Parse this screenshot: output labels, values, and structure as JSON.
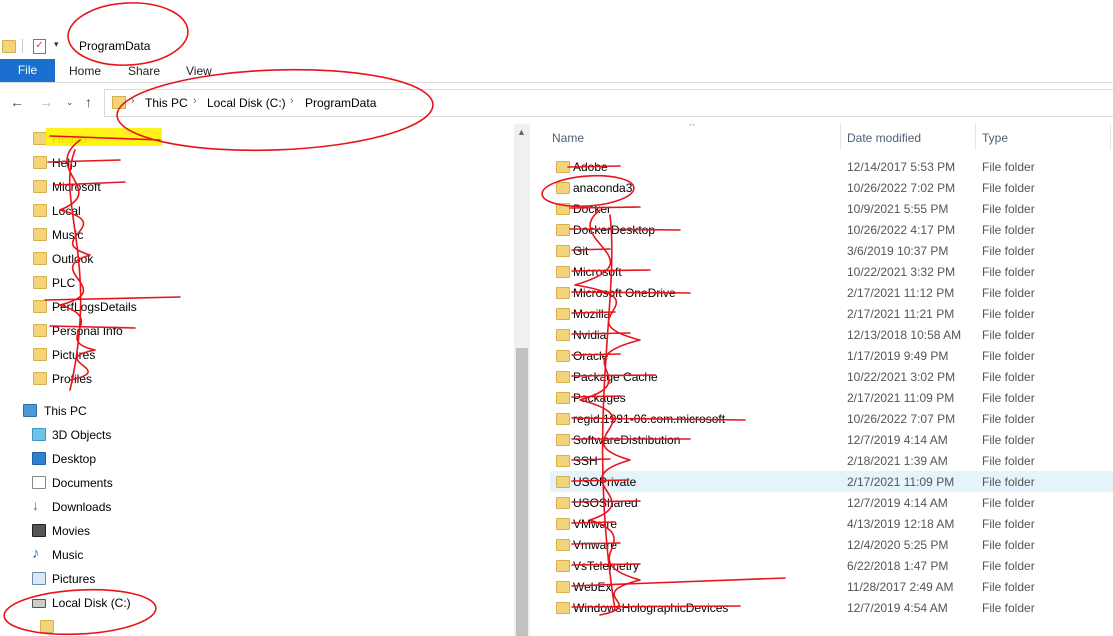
{
  "window": {
    "title": "ProgramData"
  },
  "ribbon": {
    "tabs": [
      "File",
      "Home",
      "Share",
      "View"
    ]
  },
  "address": {
    "crumbs": [
      "This PC",
      "Local Disk (C:)",
      "ProgramData"
    ],
    "separator": "›"
  },
  "nav_pane": {
    "folders": [
      "Health",
      "Help",
      "Microsoft",
      "Local",
      "Music",
      "Outlook",
      "PLC",
      "PerfLogsDetails",
      "Personal Info",
      "Pictures",
      "Profiles"
    ],
    "this_pc": "This PC",
    "pc_items": [
      {
        "label": "3D Objects",
        "icon": "3d-objects-icon"
      },
      {
        "label": "Desktop",
        "icon": "desktop-icon"
      },
      {
        "label": "Documents",
        "icon": "documents-icon"
      },
      {
        "label": "Downloads",
        "icon": "downloads-icon"
      },
      {
        "label": "Movies",
        "icon": "movies-icon"
      },
      {
        "label": "Music",
        "icon": "music-icon"
      },
      {
        "label": "Pictures",
        "icon": "pictures-icon"
      }
    ],
    "drive": "Local Disk (C:)"
  },
  "list": {
    "columns": {
      "name": "Name",
      "date": "Date modified",
      "type": "Type"
    },
    "rows": [
      {
        "name": "Adobe",
        "date": "12/14/2017 5:53 PM",
        "type": "File folder"
      },
      {
        "name": "anaconda3",
        "date": "10/26/2022 7:02 PM",
        "type": "File folder"
      },
      {
        "name": "Docker",
        "date": "10/9/2021 5:55 PM",
        "type": "File folder"
      },
      {
        "name": "DockerDesktop",
        "date": "10/26/2022 4:17 PM",
        "type": "File folder"
      },
      {
        "name": "Git",
        "date": "3/6/2019 10:37 PM",
        "type": "File folder"
      },
      {
        "name": "Microsoft",
        "date": "10/22/2021 3:32 PM",
        "type": "File folder"
      },
      {
        "name": "Microsoft OneDrive",
        "date": "2/17/2021 11:12 PM",
        "type": "File folder"
      },
      {
        "name": "Mozilla",
        "date": "2/17/2021 11:21 PM",
        "type": "File folder"
      },
      {
        "name": "Nvidia",
        "date": "12/13/2018 10:58 AM",
        "type": "File folder"
      },
      {
        "name": "Oracle",
        "date": "1/17/2019 9:49 PM",
        "type": "File folder"
      },
      {
        "name": "Package Cache",
        "date": "10/22/2021 3:02 PM",
        "type": "File folder"
      },
      {
        "name": "Packages",
        "date": "2/17/2021 11:09 PM",
        "type": "File folder"
      },
      {
        "name": "regid.1991-06.com.microsoft",
        "date": "10/26/2022 7:07 PM",
        "type": "File folder"
      },
      {
        "name": "SoftwareDistribution",
        "date": "12/7/2019 4:14 AM",
        "type": "File folder"
      },
      {
        "name": "SSH",
        "date": "2/18/2021 1:39 AM",
        "type": "File folder"
      },
      {
        "name": "USOPrivate",
        "date": "2/17/2021 11:09 PM",
        "type": "File folder"
      },
      {
        "name": "USOShared",
        "date": "12/7/2019 4:14 AM",
        "type": "File folder"
      },
      {
        "name": "VMware",
        "date": "4/13/2019 12:18 AM",
        "type": "File folder"
      },
      {
        "name": "Vmware",
        "date": "12/4/2020 5:25 PM",
        "type": "File folder"
      },
      {
        "name": "VsTelemetry",
        "date": "6/22/2018 1:47 PM",
        "type": "File folder"
      },
      {
        "name": "WebEx",
        "date": "11/28/2017 2:49 AM",
        "type": "File folder"
      },
      {
        "name": "WindowsHolographicDevices",
        "date": "12/7/2019 4:54 AM",
        "type": "File folder"
      }
    ],
    "selected_index": 15
  },
  "annotation_color": "#e8141b",
  "highlight_color": "#fff200"
}
